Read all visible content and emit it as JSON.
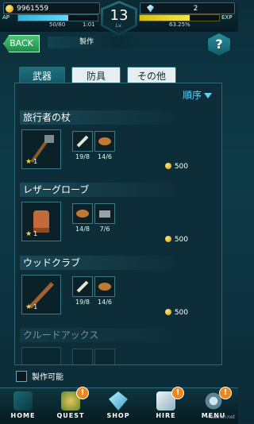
{
  "status": {
    "gold": "9961559",
    "gems": "2",
    "ap_label": "AP",
    "ap_value": "50/80",
    "ap_fraction": 0.625,
    "timer": "1:01",
    "level": "13",
    "level_label": "Lv.",
    "exp_percent_text": "63.25%",
    "exp_fraction": 0.6325,
    "exp_label": "EXP"
  },
  "header": {
    "back_label": "BACK",
    "title": "製作",
    "help_label": "?"
  },
  "tabs": [
    {
      "label": "武器",
      "active": true
    },
    {
      "label": "防具",
      "active": false
    },
    {
      "label": "その他",
      "active": false
    }
  ],
  "sort_label": "順序",
  "items": [
    {
      "name": "旅行者の杖",
      "stars": "1",
      "materials": [
        {
          "icon": "bone-material-icon",
          "stars": "1",
          "count": "19/8"
        },
        {
          "icon": "pelt-material-icon",
          "stars": "1",
          "count": "14/6"
        }
      ],
      "price": "500"
    },
    {
      "name": "レザーグローブ",
      "stars": "1",
      "materials": [
        {
          "icon": "pelt-material-icon",
          "stars": "1",
          "count": "14/8"
        },
        {
          "icon": "stone-material-icon",
          "stars": "1",
          "count": "7/6"
        }
      ],
      "price": "500"
    },
    {
      "name": "ウッドクラブ",
      "stars": "1",
      "materials": [
        {
          "icon": "bone-material-icon",
          "stars": "1",
          "count": "19/8"
        },
        {
          "icon": "pelt-material-icon",
          "stars": "1",
          "count": "14/6"
        }
      ],
      "price": "500"
    },
    {
      "name": "クルードアックス",
      "stars": "",
      "materials": [],
      "price": ""
    }
  ],
  "craftable_label": "製作可能",
  "nav": [
    {
      "label": "HOME",
      "badge": ""
    },
    {
      "label": "QUEST",
      "badge": "!"
    },
    {
      "label": "SHOP",
      "badge": ""
    },
    {
      "label": "HIRE",
      "badge": "!"
    },
    {
      "label": "MENU",
      "badge": "!"
    }
  ],
  "watermark": "4Gamer.net",
  "colors": {
    "accent": "#5cd3ff",
    "ap": "#2ab7e0",
    "exp": "#f4e640",
    "back": "#1f8a49",
    "badge": "#f2861c"
  }
}
